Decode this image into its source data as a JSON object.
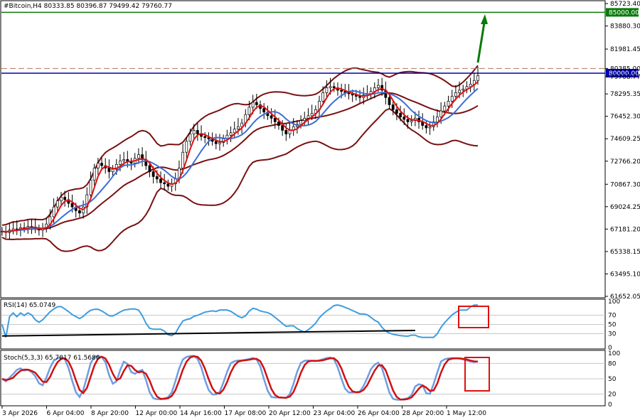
{
  "chart_data": {
    "type": "candlestick",
    "symbol_header": "#Bitcoin,H4  80333.85 80396.87 79499.42 79760.77",
    "ohlc": {
      "open": 80333.85,
      "high": 80396.87,
      "low": 79499.42,
      "close": 79760.77
    },
    "price_axis": {
      "ticks": [
        "85723.40",
        "83880.30",
        "81981.45",
        "80385.00",
        "79708.77",
        "78295.35",
        "76452.30",
        "74609.25",
        "72766.20",
        "70867.30",
        "69024.25",
        "67181.20",
        "65338.15",
        "63495.10",
        "61652.05"
      ],
      "ylim": [
        61652.05,
        85723.4
      ]
    },
    "levels": [
      {
        "label": "85000.00",
        "value": 85000.0,
        "color": "#0a7a0a",
        "style": "solid"
      },
      {
        "label": "80385.00",
        "value": 80385.0,
        "color": "#b07a5a",
        "style": "dashed"
      },
      {
        "label": "80000.00",
        "value": 80000.0,
        "color": "#0000b4",
        "style": "solid"
      }
    ],
    "time_axis": [
      "3 Apr 2026",
      "6 Apr 04:00",
      "8 Apr 20:00",
      "12 Apr 00:00",
      "14 Apr 16:00",
      "17 Apr 08:00",
      "20 Apr 12:00",
      "23 Apr 04:00",
      "26 Apr 04:00",
      "28 Apr 20:00",
      "1 May 12:00"
    ],
    "closes": [
      67000,
      66900,
      67100,
      67200,
      67150,
      67300,
      67250,
      67400,
      67350,
      67200,
      67100,
      67250,
      67600,
      68200,
      69000,
      69500,
      69800,
      69600,
      69300,
      69000,
      68700,
      68500,
      69000,
      70000,
      71200,
      72200,
      72600,
      72400,
      72200,
      71900,
      72100,
      72500,
      72800,
      72900,
      72700,
      72600,
      73000,
      73300,
      72900,
      72400,
      71900,
      71500,
      71300,
      71000,
      70900,
      70700,
      70900,
      71300,
      72200,
      73500,
      74400,
      75000,
      75300,
      75000,
      74800,
      74700,
      74600,
      74400,
      74200,
      74300,
      74600,
      74900,
      75100,
      75400,
      75600,
      75900,
      76600,
      77200,
      77600,
      77400,
      77100,
      76800,
      76500,
      76300,
      76000,
      75700,
      75300,
      75000,
      75300,
      75600,
      75800,
      76100,
      76300,
      76500,
      76700,
      77000,
      77700,
      78400,
      78800,
      78900,
      78800,
      78600,
      78500,
      78400,
      78300,
      78200,
      78100,
      78000,
      78200,
      78300,
      78500,
      78800,
      79000,
      78600,
      78000,
      77400,
      77000,
      76700,
      76400,
      76200,
      76000,
      76100,
      76300,
      76000,
      75700,
      75500,
      75600,
      76000,
      76400,
      76900,
      77300,
      77700,
      78100,
      78400,
      78600,
      78700,
      78900,
      79100,
      79400,
      79800
    ],
    "rsi": {
      "label": "RSI(14) 65.0749",
      "ticks": [
        "100",
        "70",
        "50",
        "30",
        "0"
      ],
      "ylim": [
        0,
        100
      ]
    },
    "stoch": {
      "label": "Stoch(5,3,3) 65.7017 61.5686",
      "ticks": [
        "100",
        "80",
        "50",
        "20",
        "0"
      ],
      "ylim": [
        0,
        100
      ]
    }
  }
}
